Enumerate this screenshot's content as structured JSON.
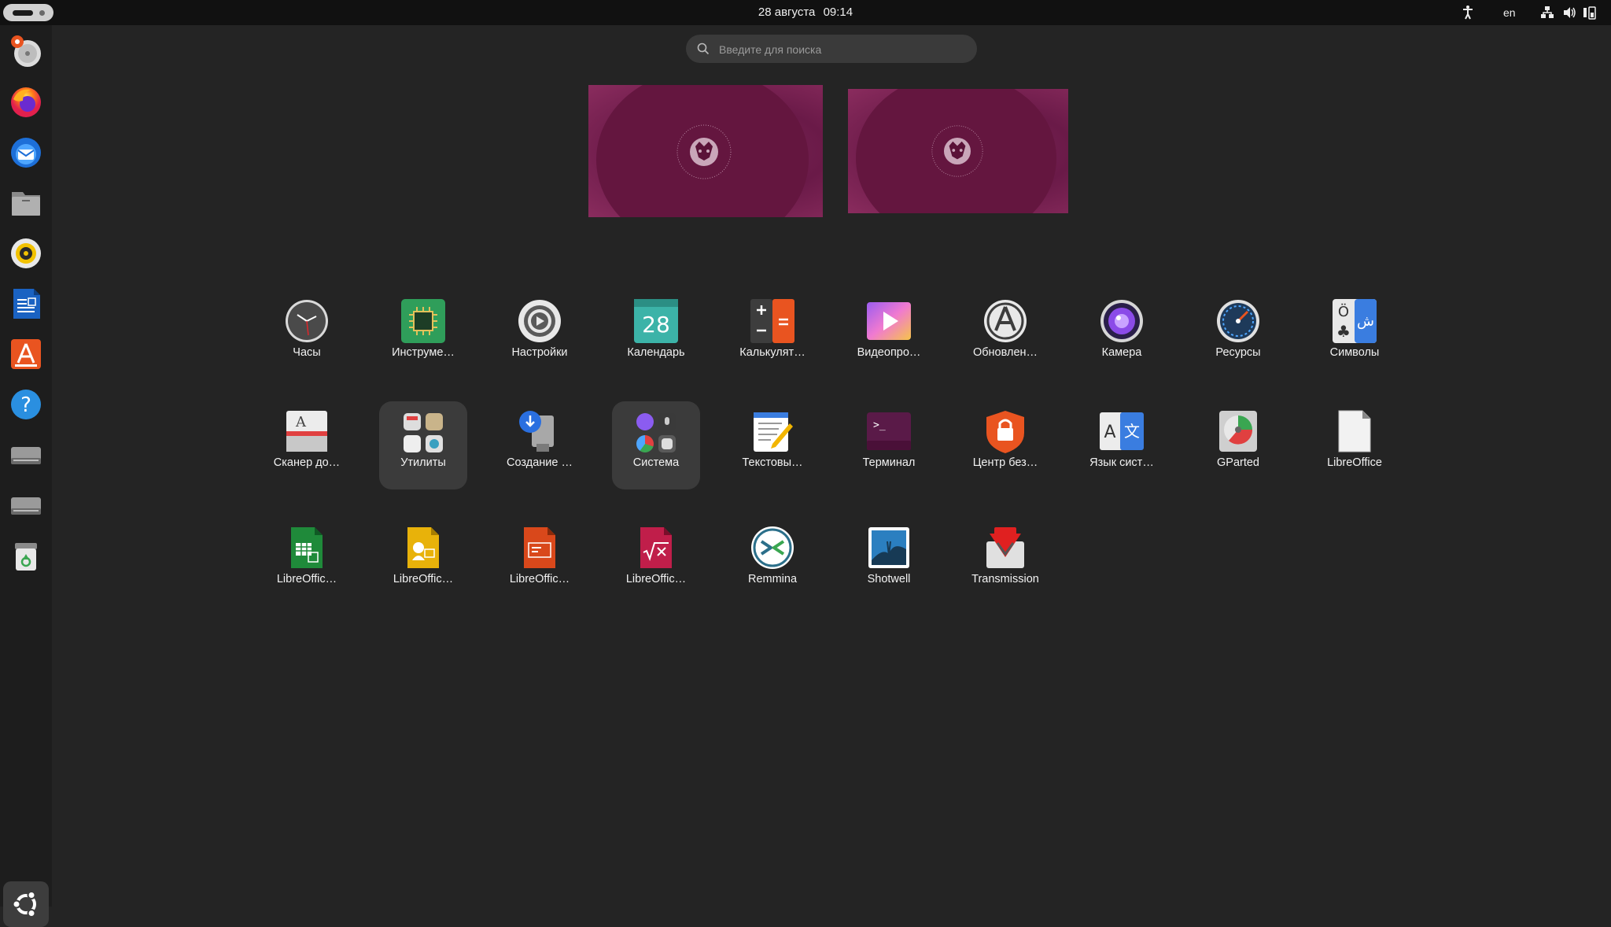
{
  "topbar": {
    "date": "28 августа",
    "time": "09:14",
    "keyboard_layout": "en",
    "icons": [
      "accessibility-icon",
      "network-icon",
      "volume-icon",
      "battery-icon"
    ]
  },
  "search": {
    "placeholder": "Введите для поиска"
  },
  "dock": {
    "items": [
      "disk-utility",
      "firefox",
      "thunderbird",
      "files",
      "rhythmbox",
      "libreoffice-writer",
      "app-center",
      "help",
      "drive",
      "drive",
      "trash",
      "show-applications"
    ]
  },
  "apps": [
    {
      "label": "Часы",
      "icon": "clock-icon"
    },
    {
      "label": "Инструме…",
      "icon": "chip-icon"
    },
    {
      "label": "Настройки",
      "icon": "settings-gear-icon"
    },
    {
      "label": "Календарь",
      "icon": "calendar-icon",
      "icon_text": "28"
    },
    {
      "label": "Калькулят…",
      "icon": "calculator-icon"
    },
    {
      "label": "Видеопро…",
      "icon": "video-player-icon"
    },
    {
      "label": "Обновлен…",
      "icon": "software-updater-icon"
    },
    {
      "label": "Камера",
      "icon": "camera-icon"
    },
    {
      "label": "Ресурсы",
      "icon": "resources-gauge-icon"
    },
    {
      "label": "Символы",
      "icon": "characters-icon"
    },
    {
      "label": "Сканер до…",
      "icon": "document-scanner-icon"
    },
    {
      "label": "Утилиты",
      "icon": "utilities-folder-icon"
    },
    {
      "label": "Создание …",
      "icon": "startup-disk-creator-icon"
    },
    {
      "label": "Система",
      "icon": "system-folder-icon"
    },
    {
      "label": "Текстовы…",
      "icon": "text-editor-icon"
    },
    {
      "label": "Терминал",
      "icon": "terminal-icon",
      "icon_text": ">_"
    },
    {
      "label": "Центр без…",
      "icon": "security-lock-icon"
    },
    {
      "label": "Язык сист…",
      "icon": "language-support-icon"
    },
    {
      "label": "GParted",
      "icon": "gparted-icon"
    },
    {
      "label": "LibreOffice",
      "icon": "libreoffice-icon"
    },
    {
      "label": "LibreOffic…",
      "icon": "libreoffice-calc-icon"
    },
    {
      "label": "LibreOffic…",
      "icon": "libreoffice-draw-icon"
    },
    {
      "label": "LibreOffic…",
      "icon": "libreoffice-impress-icon"
    },
    {
      "label": "LibreOffic…",
      "icon": "libreoffice-math-icon"
    },
    {
      "label": "Remmina",
      "icon": "remmina-icon"
    },
    {
      "label": "Shotwell",
      "icon": "shotwell-icon"
    },
    {
      "label": "Transmission",
      "icon": "transmission-icon"
    }
  ]
}
